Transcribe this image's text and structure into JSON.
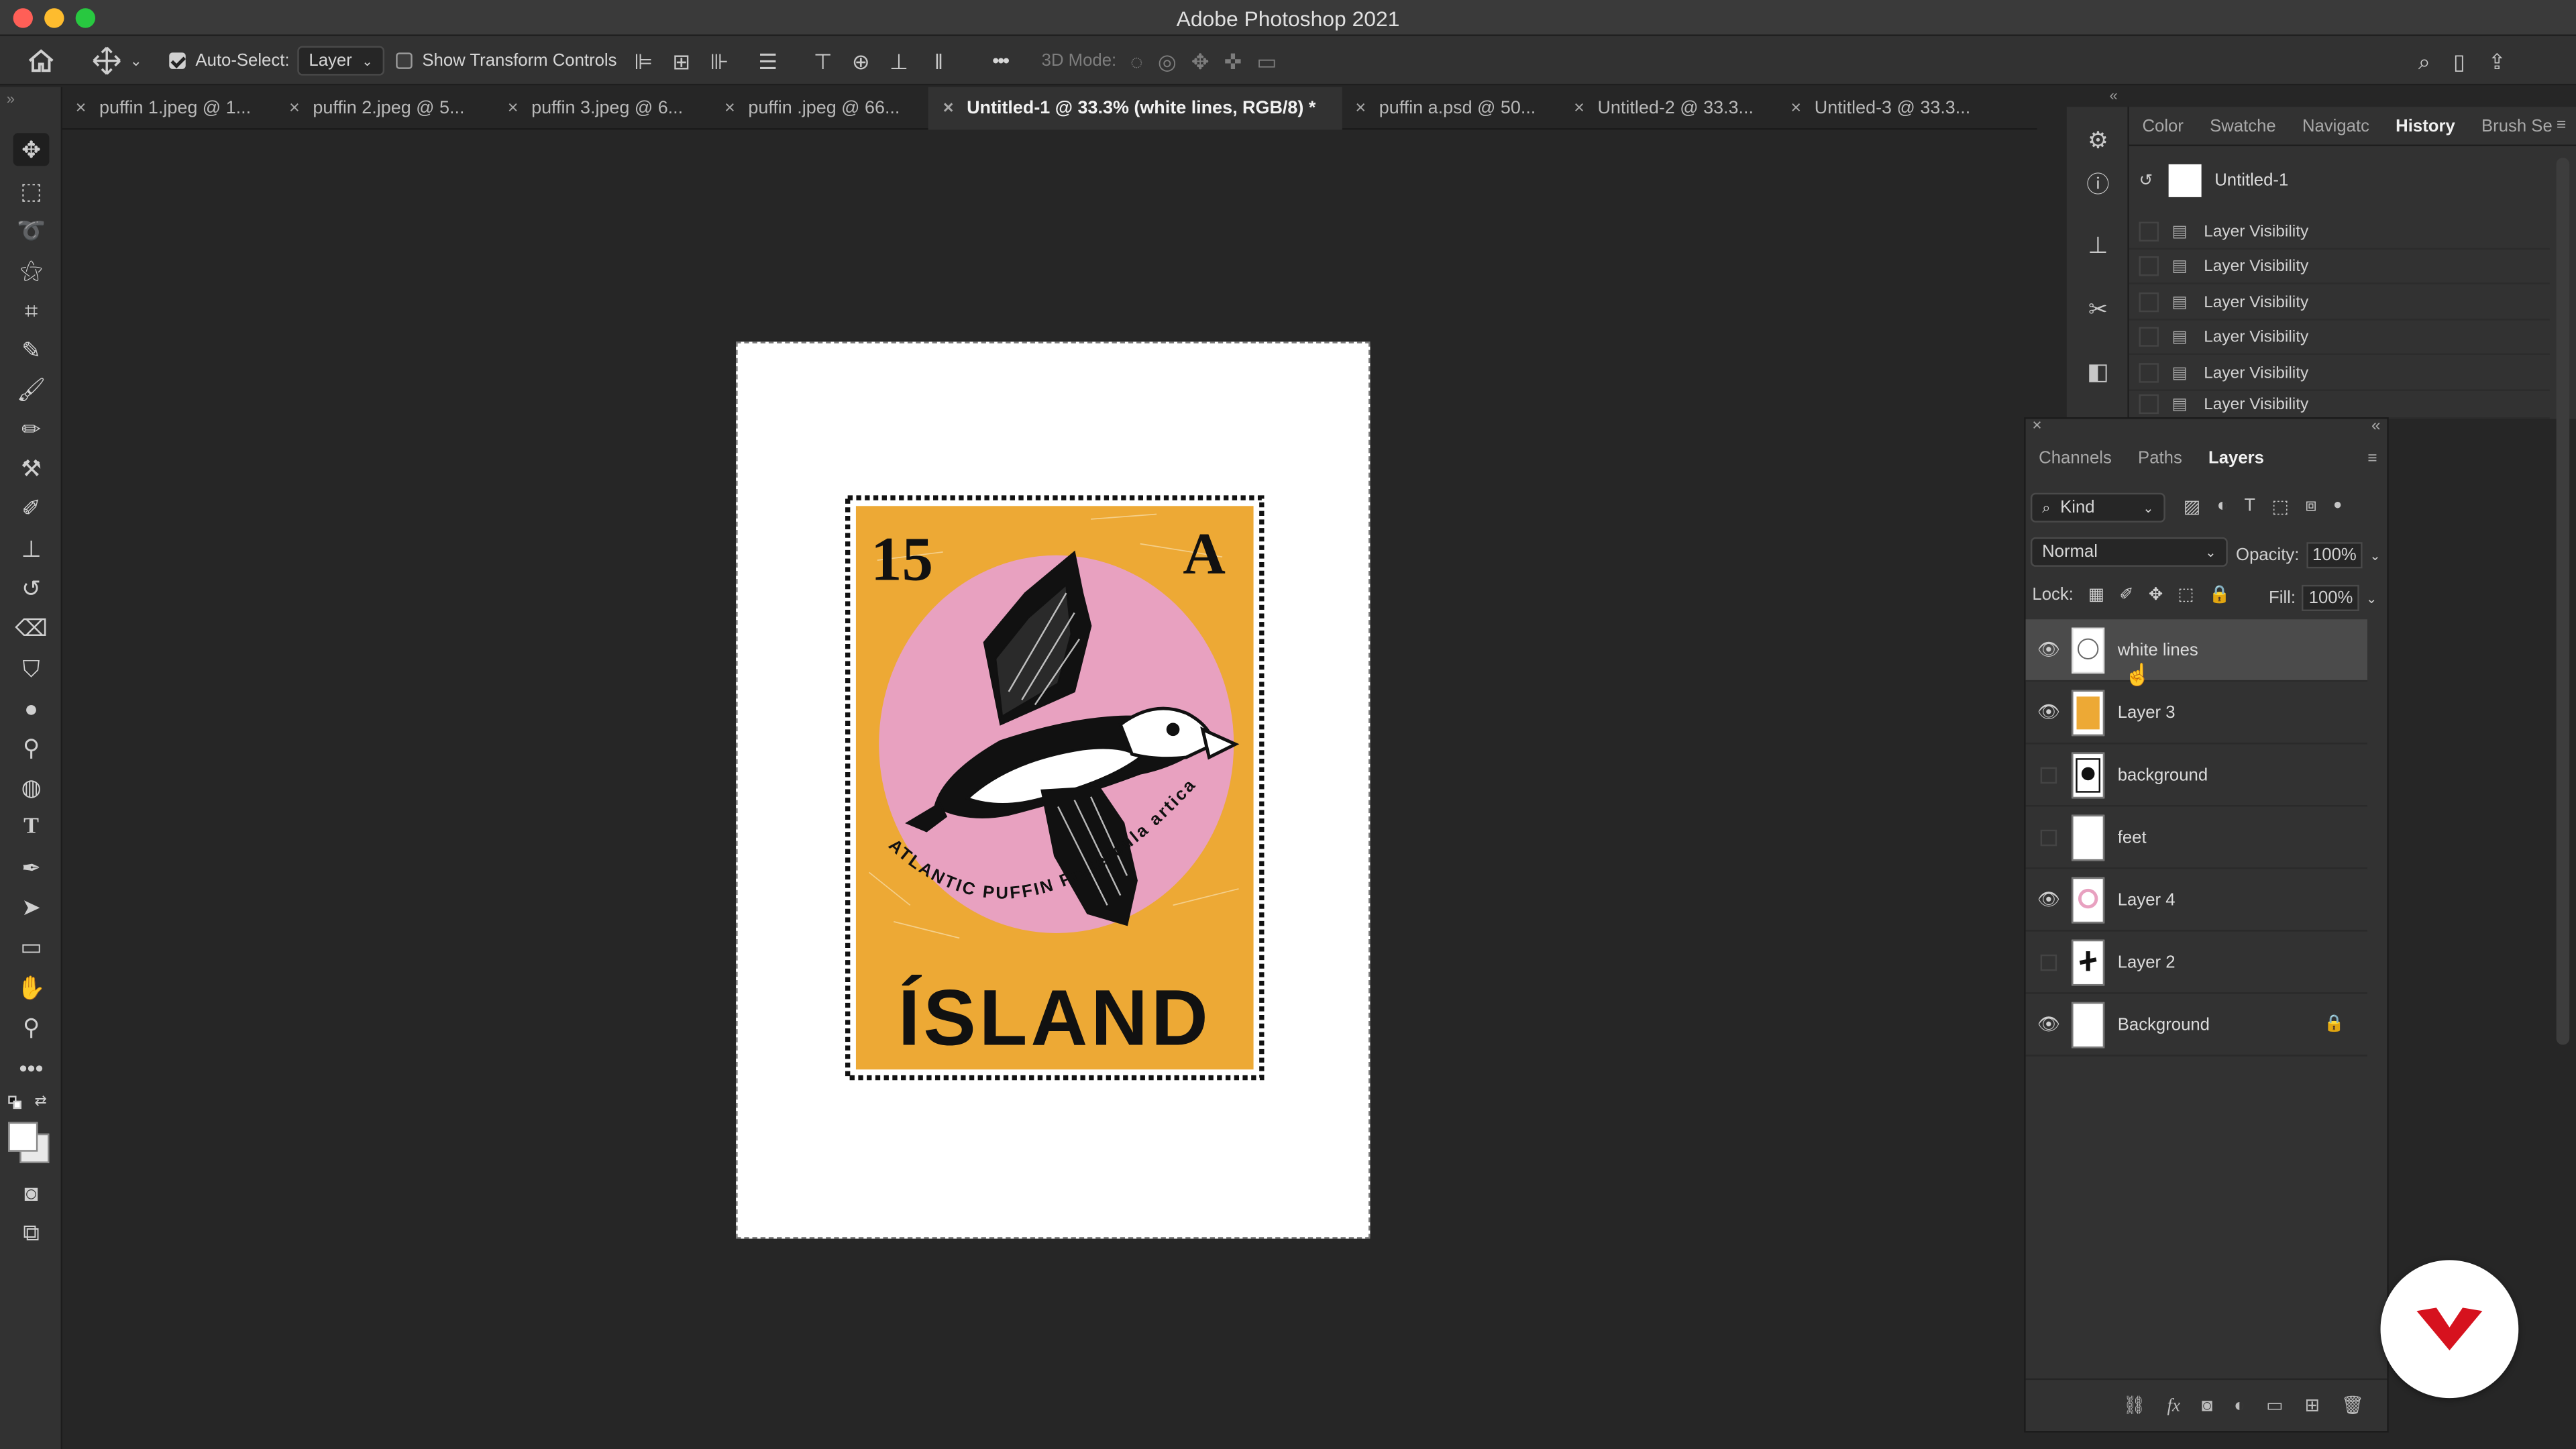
{
  "window": {
    "title": "Adobe Photoshop 2021"
  },
  "options": {
    "auto_select_label": "Auto-Select:",
    "auto_select_checked": true,
    "auto_select_value": "Layer",
    "transform_label": "Show Transform Controls",
    "transform_checked": false,
    "mode_3d_label": "3D Mode:",
    "more": "•••"
  },
  "tabs": [
    {
      "label": "puffin  1.jpeg @ 1..."
    },
    {
      "label": "puffin  2.jpeg @ 5..."
    },
    {
      "label": "puffin  3.jpeg @ 6..."
    },
    {
      "label": "puffin .jpeg @ 66..."
    },
    {
      "label": "Untitled-1 @ 33.3% (white lines, RGB/8) *"
    },
    {
      "label": "puffin a.psd @ 50..."
    },
    {
      "label": "Untitled-2 @ 33.3..."
    },
    {
      "label": "Untitled-3 @ 33.3..."
    }
  ],
  "artwork": {
    "value": "15",
    "letter": "A",
    "caption": "ATLANTIC PUFFIN Fratercula artica",
    "country": "ÍSLAND",
    "colors": {
      "frame": "#eda935",
      "circle": "#e8a1c0",
      "ink": "#111111"
    }
  },
  "history_panel": {
    "tabs": [
      "Color",
      "Swatche",
      "Navigatc",
      "History",
      "Brush Se"
    ],
    "active_tab": "History",
    "snapshot": "Untitled-1",
    "steps": [
      "Layer Visibility",
      "Layer Visibility",
      "Layer Visibility",
      "Layer Visibility",
      "Layer Visibility",
      "Layer Visibility"
    ]
  },
  "layers_panel": {
    "tabs": [
      "Channels",
      "Paths",
      "Layers"
    ],
    "active_tab": "Layers",
    "filter": "Kind",
    "blend_mode": "Normal",
    "opacity_label": "Opacity:",
    "opacity": "100%",
    "lock_label": "Lock:",
    "fill_label": "Fill:",
    "fill": "100%",
    "layers": [
      {
        "name": "white lines",
        "visible": true,
        "selected": true
      },
      {
        "name": "Layer 3",
        "visible": true
      },
      {
        "name": "background",
        "visible": false
      },
      {
        "name": "feet",
        "visible": false
      },
      {
        "name": "Layer 4",
        "visible": true
      },
      {
        "name": "Layer 2",
        "visible": false
      },
      {
        "name": "Background",
        "visible": true,
        "locked": true
      }
    ]
  },
  "badge": {
    "color": "#d6121e"
  }
}
